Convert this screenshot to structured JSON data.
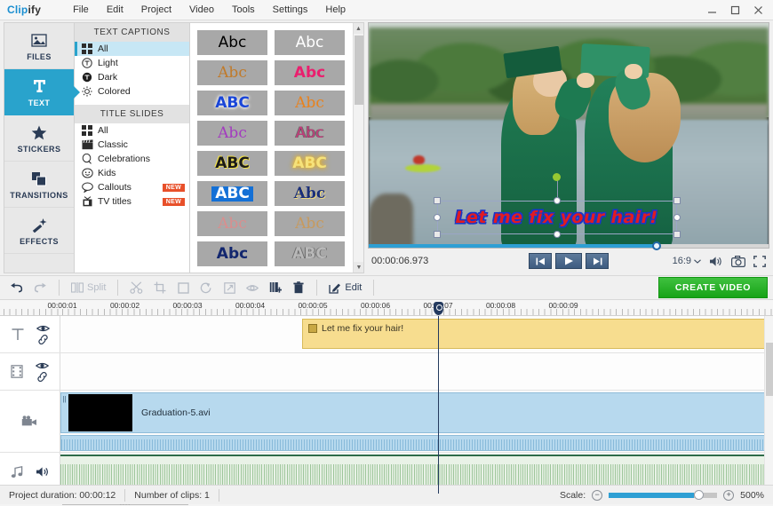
{
  "app": {
    "brand_primary": "Clip",
    "brand_secondary": "ify",
    "accent": "#29a3cc",
    "create_green": "#17a317"
  },
  "menu": [
    "File",
    "Edit",
    "Project",
    "Video",
    "Tools",
    "Settings",
    "Help"
  ],
  "window_controls": [
    "minimize",
    "maximize",
    "close"
  ],
  "sidebar": {
    "items": [
      {
        "label": "FILES",
        "icon": "image-icon",
        "active": false
      },
      {
        "label": "TEXT",
        "icon": "text-icon",
        "active": true
      },
      {
        "label": "STICKERS",
        "icon": "star-icon",
        "active": false
      },
      {
        "label": "TRANSITIONS",
        "icon": "layers-icon",
        "active": false
      },
      {
        "label": "EFFECTS",
        "icon": "magic-wand-icon",
        "active": false
      }
    ]
  },
  "categories": {
    "text_captions": {
      "header": "TEXT CAPTIONS",
      "items": [
        {
          "label": "All",
          "icon": "grid-icon",
          "selected": true,
          "badge": ""
        },
        {
          "label": "Light",
          "icon": "circle-t-outline-icon",
          "selected": false,
          "badge": ""
        },
        {
          "label": "Dark",
          "icon": "circle-t-filled-icon",
          "selected": false,
          "badge": ""
        },
        {
          "label": "Colored",
          "icon": "sun-icon",
          "selected": false,
          "badge": ""
        }
      ]
    },
    "title_slides": {
      "header": "TITLE SLIDES",
      "items": [
        {
          "label": "All",
          "icon": "grid-icon",
          "selected": false,
          "badge": ""
        },
        {
          "label": "Classic",
          "icon": "clapperboard-icon",
          "selected": false,
          "badge": ""
        },
        {
          "label": "Celebrations",
          "icon": "balloon-icon",
          "selected": false,
          "badge": ""
        },
        {
          "label": "Kids",
          "icon": "kid-face-icon",
          "selected": false,
          "badge": ""
        },
        {
          "label": "Callouts",
          "icon": "speech-bubble-icon",
          "selected": false,
          "badge": "NEW"
        },
        {
          "label": "TV titles",
          "icon": "tv-icon",
          "selected": false,
          "badge": "NEW"
        }
      ]
    }
  },
  "presets": [
    {
      "text": "Abc",
      "color": "#000000",
      "family": "sans",
      "weight": "normal",
      "style": "normal",
      "shadow": "none"
    },
    {
      "text": "Abc",
      "color": "#ffffff",
      "family": "sans",
      "weight": "normal",
      "style": "normal",
      "shadow": "none"
    },
    {
      "text": "Abc",
      "color": "#c07a2a",
      "family": "serif",
      "weight": "normal",
      "style": "normal",
      "shadow": "none"
    },
    {
      "text": "Abc",
      "color": "#ea1f6e",
      "family": "sans",
      "weight": "bold",
      "style": "normal",
      "shadow": "none"
    },
    {
      "text": "ABC",
      "color": "#1a46d8",
      "family": "sans",
      "weight": "bold",
      "style": "normal",
      "shadow": "glow-white"
    },
    {
      "text": "Abc",
      "color": "#e8821e",
      "family": "serif",
      "weight": "normal",
      "style": "normal",
      "shadow": "none"
    },
    {
      "text": "Abc",
      "color": "#a33bbf",
      "family": "serif",
      "weight": "normal",
      "style": "normal",
      "shadow": "none"
    },
    {
      "text": "Abc",
      "color": "#c53a7a",
      "family": "sans",
      "weight": "normal",
      "style": "normal",
      "shadow": "outline"
    },
    {
      "text": "ABC",
      "color": "#1a1a1a",
      "family": "sans",
      "weight": "bold",
      "style": "normal",
      "shadow": "yellow-edge"
    },
    {
      "text": "ABC",
      "color": "#f6e27a",
      "family": "sans",
      "weight": "bold",
      "style": "normal",
      "shadow": "glow-gold"
    },
    {
      "text": "ABC",
      "color": "#ffffff",
      "family": "sans",
      "weight": "bold",
      "style": "normal",
      "shadow": "blue-box"
    },
    {
      "text": "Abc",
      "color": "#1a2f7a",
      "family": "serif",
      "weight": "bold",
      "style": "normal",
      "shadow": "gold-edge"
    },
    {
      "text": "Abc",
      "color": "#d98e8e",
      "family": "serif",
      "weight": "normal",
      "style": "normal",
      "shadow": "none"
    },
    {
      "text": "Abc",
      "color": "#c79a5e",
      "family": "serif",
      "weight": "normal",
      "style": "normal",
      "shadow": "none"
    },
    {
      "text": "Abc",
      "color": "#12266e",
      "family": "sans",
      "weight": "bold",
      "style": "normal",
      "shadow": "none"
    },
    {
      "text": "ABC",
      "color": "#b8b8b8",
      "family": "sans",
      "weight": "bold",
      "style": "normal",
      "shadow": "outline"
    }
  ],
  "preview": {
    "timecode": "00:00:06.973",
    "aspect_ratio": "16:9",
    "overlay_text": "Let me fix your hair!",
    "progress_percent": 72,
    "controls": [
      {
        "name": "previous-frame-button",
        "glyph": "◀|"
      },
      {
        "name": "play-button",
        "glyph": "▶"
      },
      {
        "name": "next-frame-button",
        "glyph": "|▶"
      }
    ],
    "right_icons": [
      "volume-icon",
      "snapshot-icon",
      "fullscreen-icon"
    ]
  },
  "toolbar": {
    "undo": "undo-icon",
    "redo": "redo-icon",
    "split_label": "Split",
    "edit_label": "Edit",
    "create_label": "CREATE VIDEO",
    "tools": [
      {
        "name": "cut-icon",
        "disabled": true
      },
      {
        "name": "crop-icon",
        "disabled": true
      },
      {
        "name": "stabilize-icon",
        "disabled": true
      },
      {
        "name": "rotate-icon",
        "disabled": true
      },
      {
        "name": "pan-zoom-icon",
        "disabled": true
      },
      {
        "name": "chroma-key-icon",
        "disabled": true
      },
      {
        "name": "add-title-icon",
        "disabled": false
      },
      {
        "name": "delete-icon",
        "disabled": false
      }
    ]
  },
  "timeline": {
    "ruler_ticks": [
      "00:00:01",
      "00:00:02",
      "00:00:03",
      "00:00:04",
      "00:00:05",
      "00:00:06",
      "00:00:07",
      "00:00:08",
      "00:00:09"
    ],
    "playhead_time": "00:00:07",
    "tracks": [
      {
        "name": "text-track",
        "icon": "text-track-icon",
        "toggles": [
          "eye-icon",
          "link-icon"
        ]
      },
      {
        "name": "sticker-track",
        "icon": "filmstrip-icon",
        "toggles": [
          "eye-icon",
          "link-icon"
        ]
      },
      {
        "name": "video-track",
        "icon": "camera-icon",
        "toggles": []
      },
      {
        "name": "audio-track",
        "icon": "music-note-icon",
        "toggles": [
          "speaker-icon"
        ]
      }
    ],
    "title_clip": {
      "label": "Let me fix your hair!"
    },
    "video_clip": {
      "label": "Graduation-5.avi"
    }
  },
  "status": {
    "project_duration_label": "Project duration:",
    "project_duration_value": "00:00:12",
    "clips_label": "Number of clips:",
    "clips_value": "1",
    "scale_label": "Scale:",
    "scale_value": "500%",
    "zoom_out": "−",
    "zoom_in": "+"
  }
}
